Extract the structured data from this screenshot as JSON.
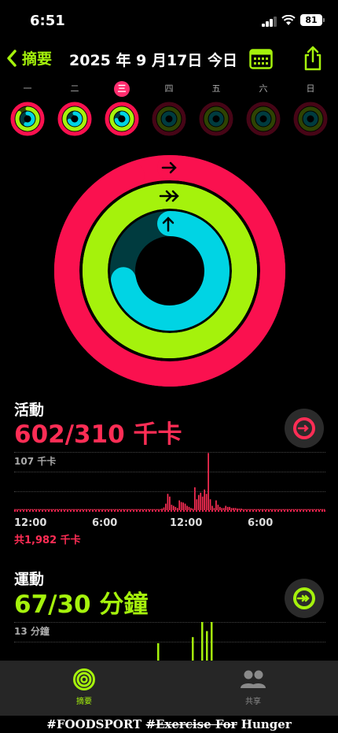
{
  "status": {
    "time": "6:51",
    "battery": "81"
  },
  "nav": {
    "back_label": "摘要",
    "title": "2025 年 9 月17日 今日"
  },
  "week": [
    {
      "label": "一",
      "selected": false,
      "active": true
    },
    {
      "label": "二",
      "selected": false,
      "active": true
    },
    {
      "label": "三",
      "selected": true,
      "active": true
    },
    {
      "label": "四",
      "selected": false,
      "active": false
    },
    {
      "label": "五",
      "selected": false,
      "active": false
    },
    {
      "label": "六",
      "selected": false,
      "active": false
    },
    {
      "label": "日",
      "selected": false,
      "active": false
    }
  ],
  "rings": {
    "move": 1.94,
    "exercise": 2.23,
    "stand": 0.72,
    "move_color": "#fa114f",
    "exercise_color": "#a5f20c",
    "stand_color": "#00d4e4"
  },
  "activity": {
    "label": "活動",
    "value": "602/310 千卡",
    "ymax": "107 千卡",
    "x_ticks": [
      "12:00",
      "6:00",
      "12:00",
      "6:00"
    ],
    "total": "共1,982 千卡",
    "color": "#ff2d55",
    "chart_data": {
      "type": "bar",
      "ylim": [
        0,
        107
      ],
      "values": [
        2,
        2,
        2,
        2,
        2,
        2,
        2,
        2,
        2,
        2,
        2,
        2,
        2,
        2,
        2,
        2,
        2,
        2,
        2,
        2,
        2,
        2,
        2,
        2,
        2,
        2,
        2,
        2,
        2,
        2,
        2,
        2,
        2,
        2,
        2,
        2,
        2,
        2,
        2,
        2,
        2,
        2,
        2,
        2,
        2,
        2,
        2,
        2,
        2,
        2,
        2,
        2,
        2,
        2,
        2,
        2,
        2,
        2,
        2,
        2,
        2,
        2,
        2,
        2,
        2,
        2,
        2,
        2,
        2,
        2,
        2,
        2,
        2,
        2,
        2,
        2,
        3,
        5,
        12,
        30,
        25,
        10,
        8,
        6,
        4,
        18,
        15,
        14,
        12,
        8,
        6,
        4,
        3,
        42,
        20,
        28,
        32,
        25,
        38,
        30,
        105,
        20,
        8,
        4,
        18,
        10,
        6,
        4,
        4,
        8,
        6,
        6,
        4,
        4,
        4,
        3,
        3,
        3,
        2,
        2,
        2,
        2,
        2,
        2,
        2,
        2,
        2,
        2,
        2,
        2,
        2,
        2,
        2,
        2,
        2,
        2,
        2,
        2,
        2,
        2,
        2,
        2,
        2,
        2,
        2,
        2,
        2,
        2,
        2,
        2,
        2,
        2,
        2,
        2,
        2,
        2,
        2,
        2,
        2,
        2,
        2
      ]
    }
  },
  "exercise": {
    "label": "運動",
    "value": "67/30 分鐘",
    "ymax": "13 分鐘",
    "color": "#a5f20c",
    "chart_data": {
      "type": "bar",
      "ylim": [
        0,
        13
      ],
      "values": [
        0,
        0,
        0,
        0,
        0,
        0,
        0,
        0,
        0,
        0,
        0,
        0,
        0,
        0,
        0,
        0,
        0,
        0,
        0,
        0,
        0,
        0,
        0,
        0,
        0,
        0,
        0,
        0,
        0,
        0,
        0,
        0,
        0,
        0,
        0,
        0,
        0,
        0,
        0,
        0,
        0,
        0,
        0,
        0,
        0,
        0,
        0,
        0,
        0,
        0,
        0,
        0,
        0,
        0,
        0,
        0,
        0,
        0,
        0,
        0,
        0,
        0,
        0,
        0,
        0,
        0,
        0,
        0,
        0,
        0,
        0,
        0,
        0,
        0,
        0,
        0,
        0,
        0,
        0,
        0,
        0,
        0,
        0,
        0,
        0,
        0,
        0,
        0,
        0,
        0,
        0,
        0,
        0,
        0,
        0,
        0,
        0,
        0,
        0,
        0,
        0,
        0,
        0,
        0,
        0,
        0,
        0,
        0,
        0,
        0,
        0,
        0,
        0,
        0,
        0,
        0,
        0,
        0,
        0,
        0,
        0,
        0,
        0,
        0,
        0,
        0,
        0,
        0,
        0,
        0,
        0,
        0,
        0,
        0,
        0,
        0,
        0,
        0,
        0,
        0,
        0,
        0,
        0,
        0,
        0,
        0,
        0,
        0,
        0,
        0,
        0,
        0,
        0,
        0,
        0,
        0,
        0,
        0,
        0,
        0,
        0,
        0,
        0,
        0,
        0
      ]
    },
    "highlights": [
      6,
      8,
      13,
      10,
      13
    ]
  },
  "tabbar": {
    "summary_label": "摘要",
    "sharing_label": "共享"
  },
  "footer": {
    "text_a": "#FOODSPORT ",
    "text_b": "#Exercise For",
    "text_c": " Hunger"
  }
}
